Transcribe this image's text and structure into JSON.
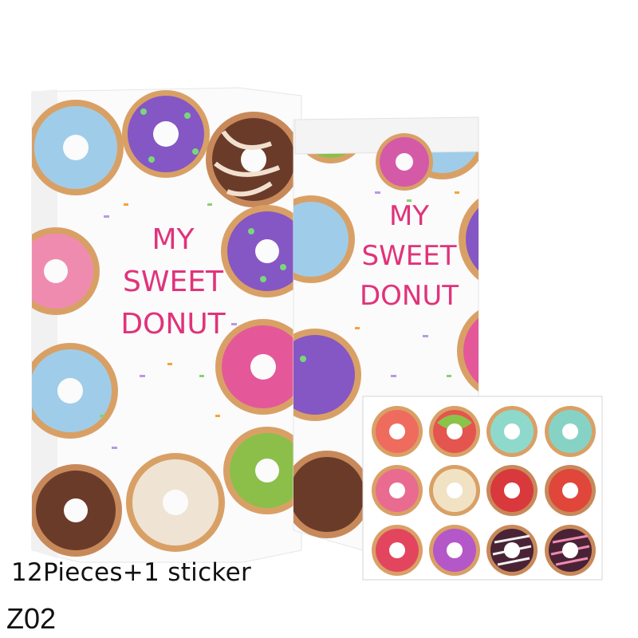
{
  "bag_back": {
    "line1": "MY",
    "line2": "SWEET",
    "line3": "DONUT"
  },
  "bag_front": {
    "line1": "MY",
    "line2": "SWEET",
    "line3": "DONUT"
  },
  "caption": "12Pieces+1 sticker",
  "product_code": "Z02",
  "colors": {
    "title_pink": "#e0337a",
    "blue_icing": "#9fcde9",
    "purple_icing": "#8557c4",
    "chocolate": "#6b3b2a",
    "pink_icing": "#e4589a",
    "green_icing": "#8bbf4a",
    "dough": "#d9a066"
  }
}
